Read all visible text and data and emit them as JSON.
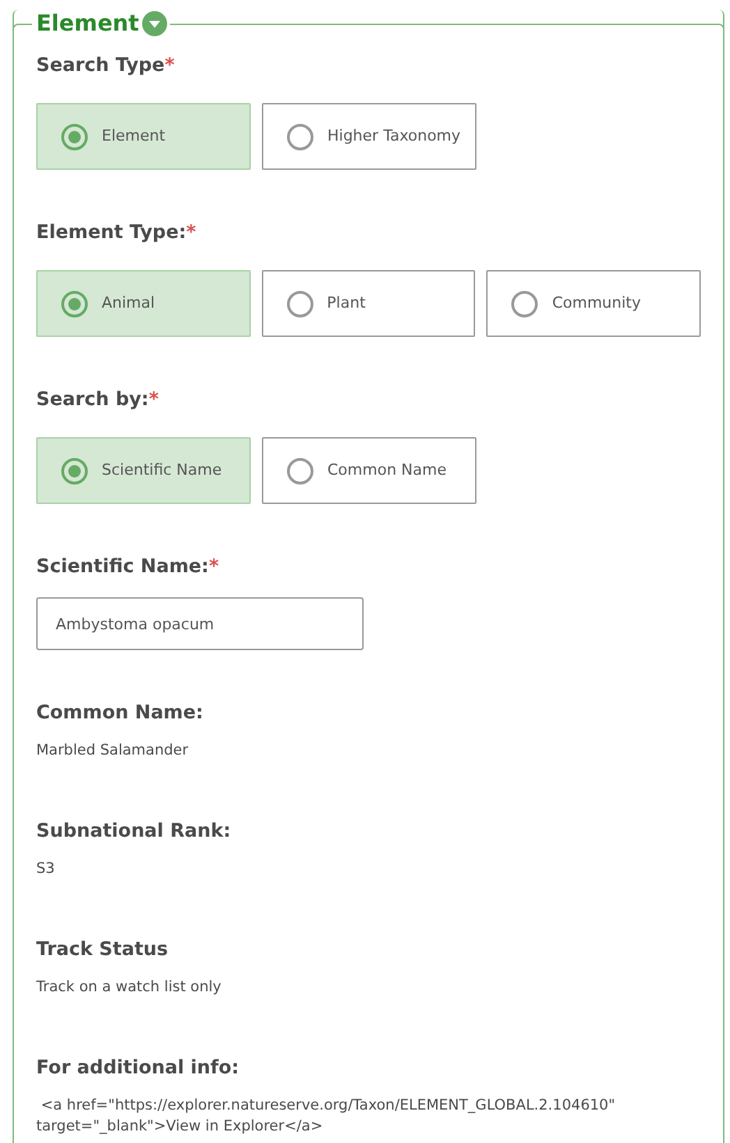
{
  "fieldset": {
    "legend": "Element",
    "expanded": true
  },
  "sections": [
    {
      "kind": "radio",
      "label": "Search Type",
      "required_mark": "*",
      "options": [
        {
          "label": "Element",
          "selected": true
        },
        {
          "label": "Higher Taxonomy",
          "selected": false
        }
      ]
    },
    {
      "kind": "radio",
      "label": "Element Type:",
      "required_mark": "*",
      "options": [
        {
          "label": "Animal",
          "selected": true
        },
        {
          "label": "Plant",
          "selected": false
        },
        {
          "label": "Community",
          "selected": false
        }
      ]
    },
    {
      "kind": "radio",
      "label": "Search by:",
      "required_mark": "*",
      "options": [
        {
          "label": "Scientific Name",
          "selected": true
        },
        {
          "label": "Common Name",
          "selected": false
        }
      ]
    },
    {
      "kind": "input",
      "label": "Scientific Name:",
      "required_mark": "*",
      "value": "Ambystoma opacum"
    },
    {
      "kind": "info",
      "label": "Common Name:",
      "value": "Marbled Salamander"
    },
    {
      "kind": "info",
      "label": "Subnational Rank:",
      "value": "S3"
    },
    {
      "kind": "info",
      "label": "Track Status",
      "value": "Track on a watch list only"
    },
    {
      "kind": "info",
      "label": "For additional info:",
      "value": " <a href=\"https://explorer.natureserve.org/Taxon/ELEMENT_GLOBAL.2.104610\" target=\"_blank\">View in Explorer</a>"
    }
  ]
}
